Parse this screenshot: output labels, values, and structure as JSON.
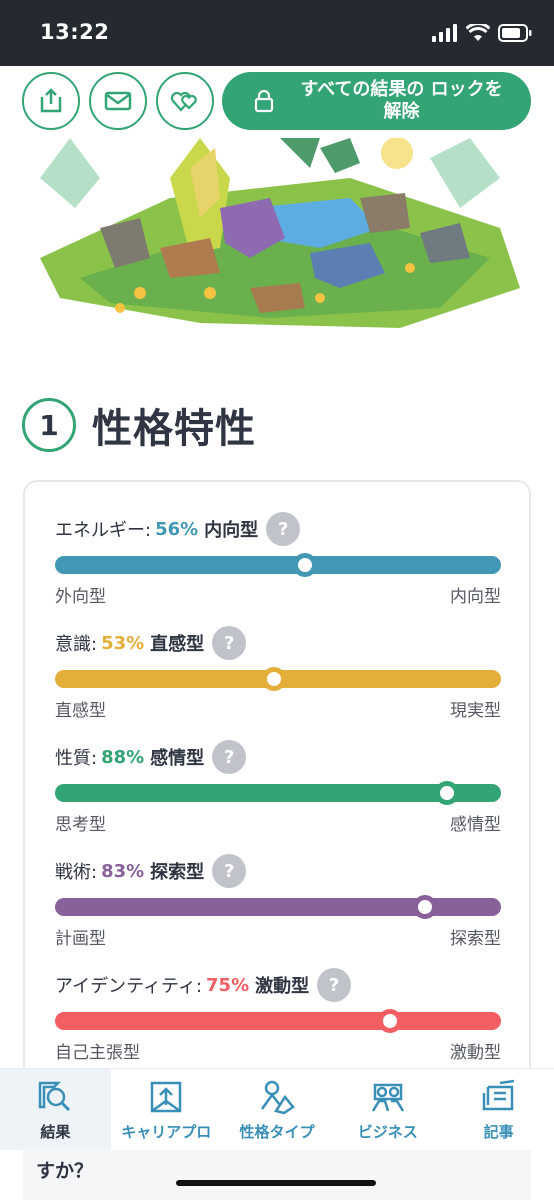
{
  "status_bar": {
    "time": "13:22"
  },
  "header": {
    "unlock_label": "すべての結果の ロックを解除"
  },
  "section": {
    "number": "1",
    "title": "性格特性"
  },
  "traits": [
    {
      "name": "エネルギー:",
      "percent": "56%",
      "type": "内向型",
      "value": 0.56,
      "color": "#4298b4",
      "left_label": "外向型",
      "right_label": "内向型"
    },
    {
      "name": "意識:",
      "percent": "53%",
      "type": "直感型",
      "value": 0.49,
      "color": "#e4ae3a",
      "left_label": "直感型",
      "right_label": "現実型"
    },
    {
      "name": "性質:",
      "percent": "88%",
      "type": "感情型",
      "value": 0.88,
      "color": "#33a474",
      "left_label": "思考型",
      "right_label": "感情型"
    },
    {
      "name": "戦術:",
      "percent": "83%",
      "type": "探索型",
      "value": 0.83,
      "color": "#88619a",
      "left_label": "計画型",
      "right_label": "探索型"
    },
    {
      "name": "アイデンティティ:",
      "percent": "75%",
      "type": "激動型",
      "value": 0.75,
      "color": "#f25e62",
      "left_label": "自己主張型",
      "right_label": "激動型"
    }
  ],
  "help_symbol": "?",
  "peek_text": "結果をメールで送信しますか？それとも友達と比較しますか？",
  "nav": [
    {
      "label": "結果",
      "icon": "results-icon"
    },
    {
      "label": "キャリアプロ",
      "icon": "career-icon"
    },
    {
      "label": "性格タイプ",
      "icon": "personality-types-icon"
    },
    {
      "label": "ビジネス",
      "icon": "business-icon"
    },
    {
      "label": "記事",
      "icon": "articles-icon"
    }
  ],
  "colors": {
    "accent": "#33a474",
    "nav_text": "#3a8fb7"
  }
}
